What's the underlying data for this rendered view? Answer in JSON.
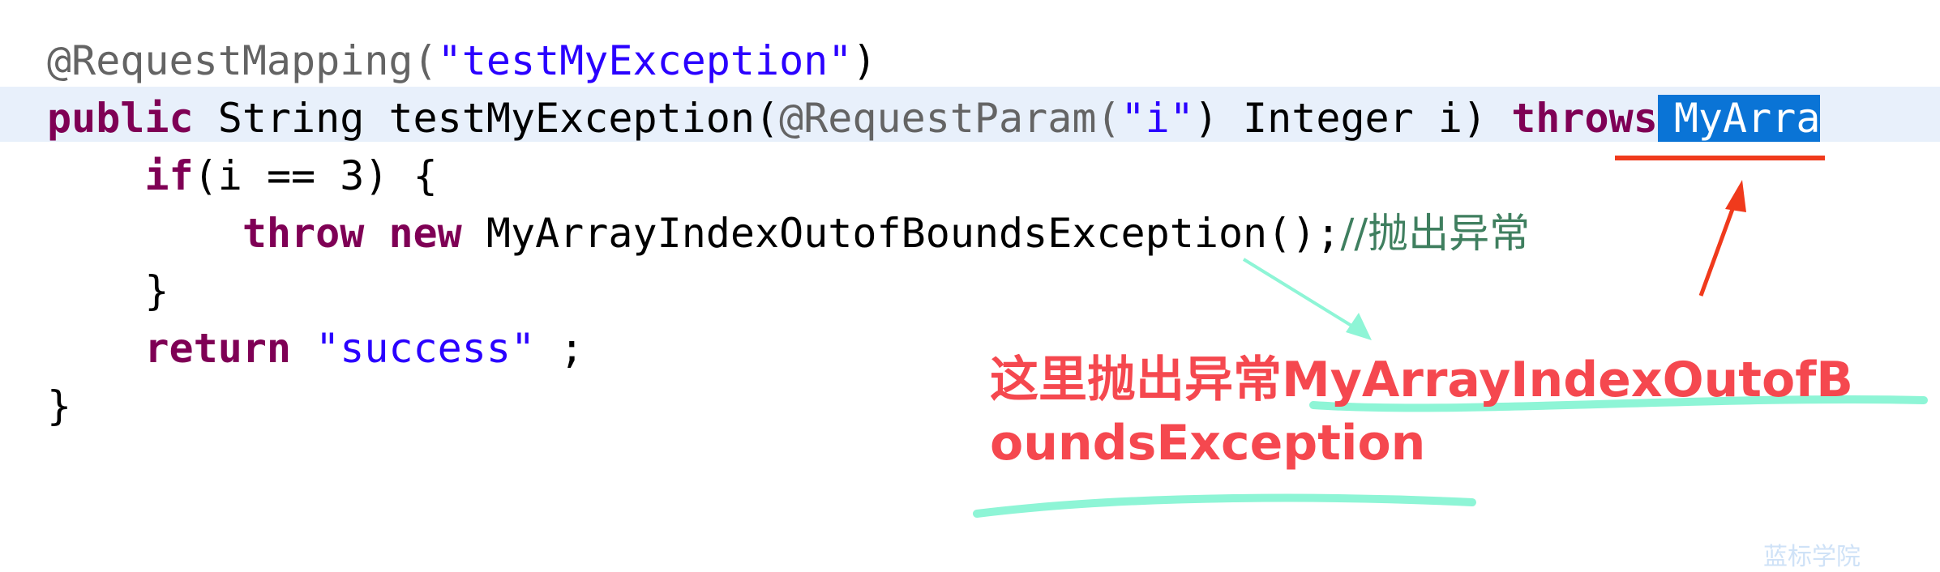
{
  "code": {
    "line1": {
      "annotation": "@RequestMapping(",
      "string": "\"testMyException\"",
      "close": ")"
    },
    "line2": {
      "kw_public": "public",
      "mid": " String testMyException(",
      "annotation": "@RequestParam(",
      "string": "\"i\"",
      "rest": ") Integer i) ",
      "kw_throws": "throws",
      "selected": "MyArra"
    },
    "line3": {
      "indent": "    ",
      "kw_if": "if",
      "rest": "(i == 3) {"
    },
    "line4": {
      "indent": "        ",
      "kw_throw": "throw",
      "sp": " ",
      "kw_new": "new",
      "rest": " MyArrayIndexOutofBoundsException();",
      "comment": "//抛出异常"
    },
    "line5": {
      "text": "    }"
    },
    "line6": {
      "indent": "    ",
      "kw_return": "return",
      "sp": " ",
      "string": "\"success\"",
      "rest": " ;"
    },
    "line7": {
      "text": "}"
    }
  },
  "annotation_note": {
    "line1": "这里抛出异常MyArrayIndexOutofB",
    "line2": "oundsException"
  },
  "watermark": "蓝标学院",
  "colors": {
    "keyword": "#7f0055",
    "string": "#2a00ff",
    "comment": "#3f7f5f",
    "selection": "#0a74d6",
    "note": "#f5484f",
    "highlighter": "#8ef5d6",
    "arrow_red": "#f03a1c"
  }
}
